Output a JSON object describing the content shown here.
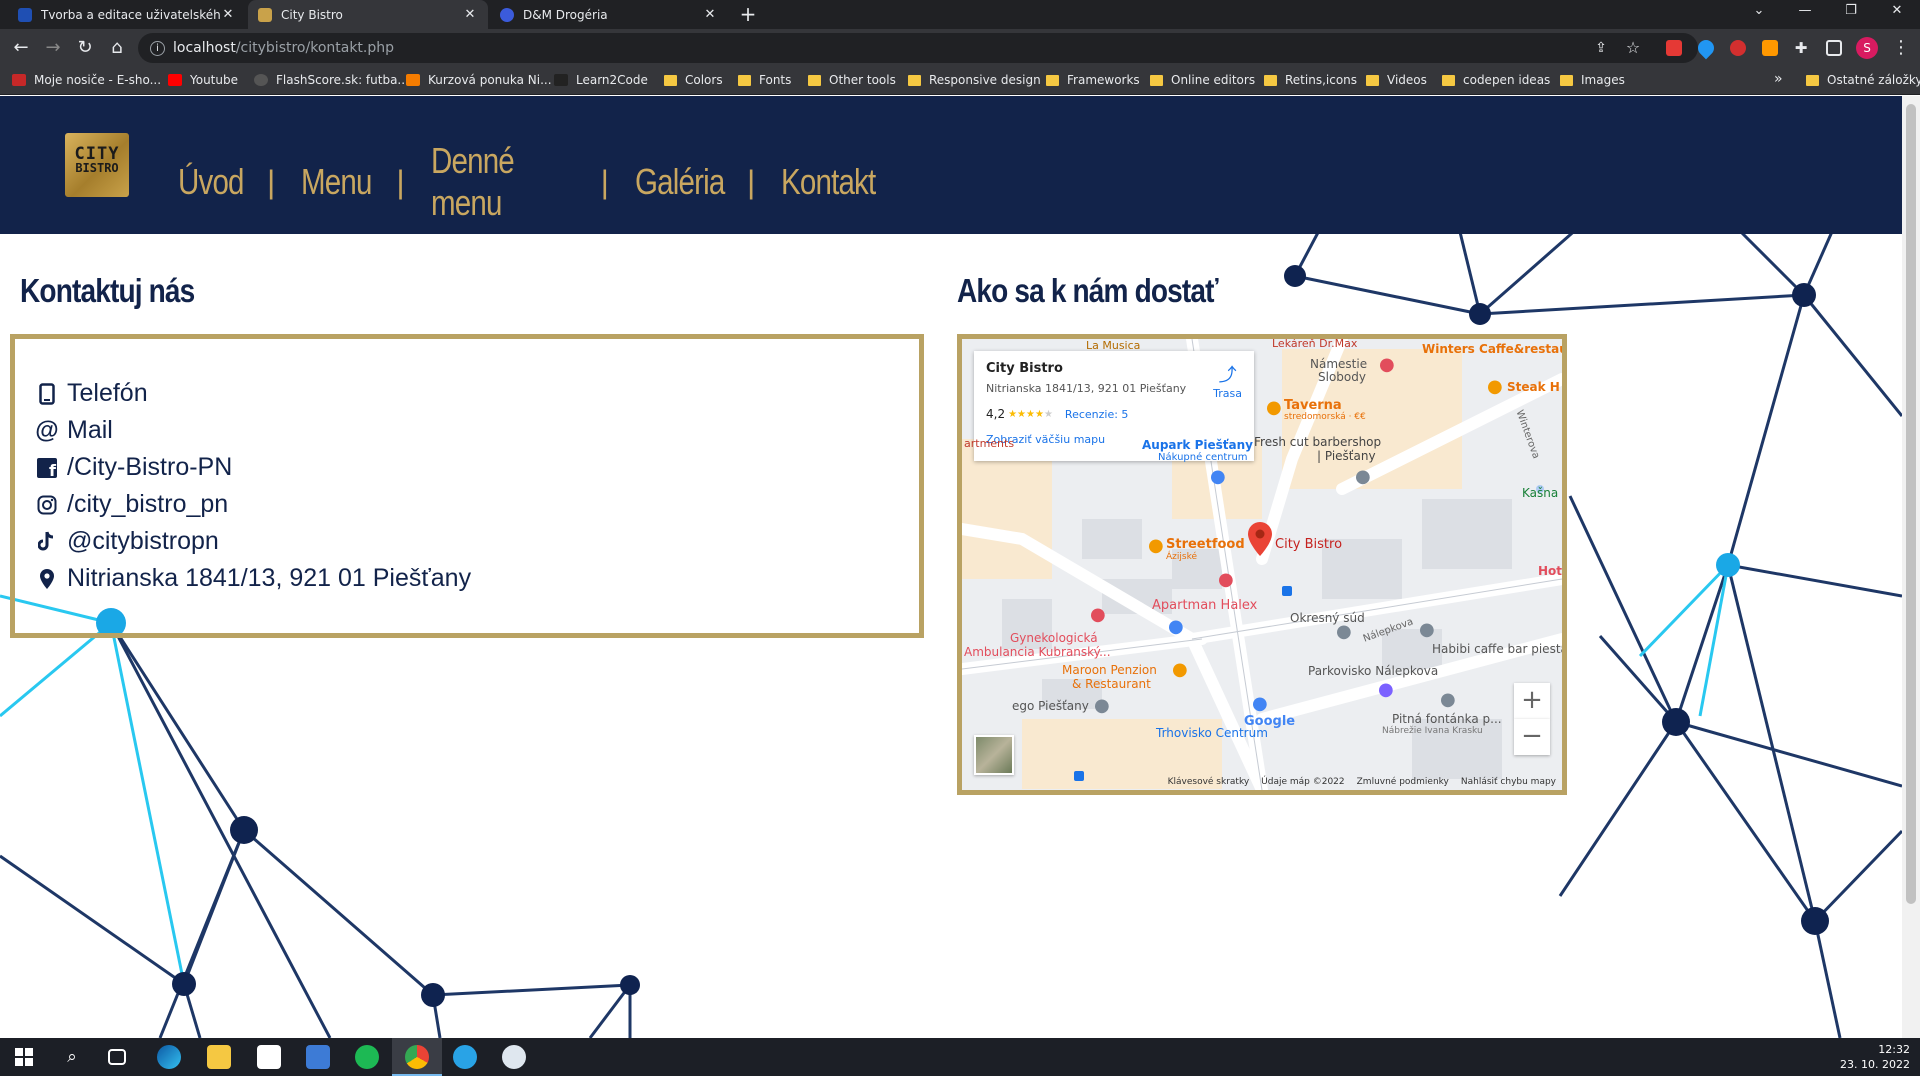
{
  "browser": {
    "tabs": [
      {
        "title": "Tvorba a editace uživatelského p",
        "icon": "sk-favicon-icon",
        "active": false
      },
      {
        "title": "City Bistro",
        "icon": "city-bistro-favicon-icon",
        "active": true
      },
      {
        "title": "D&M Drogéria",
        "icon": "dm-favicon-icon",
        "active": false
      }
    ],
    "url_host": "localhost",
    "url_path": "/citybistro/kontakt.php",
    "bookmarks": [
      "Moje nosiče - E-sho...",
      "Youtube",
      "FlashScore.sk: futba...",
      "Kurzová ponuka Ni...",
      "Learn2Code",
      "Colors",
      "Fonts",
      "Other tools",
      "Responsive design",
      "Frameworks",
      "Online editors",
      "Retins,icons",
      "Videos",
      "codepen ideas",
      "Images"
    ],
    "bookmarks_more": "»",
    "bookmarks_other": "Ostatné záložky",
    "profile_initial": "S"
  },
  "site": {
    "logo_line1": "CITY",
    "logo_line2": "BISTRO",
    "nav": [
      "Úvod",
      "Menu",
      "Denné menu",
      "Galéria",
      "Kontakt"
    ],
    "nav_separator": "|",
    "contact_heading": "Kontaktuj nás",
    "contact_items": [
      {
        "icon": "phone-icon",
        "text": "Telefón"
      },
      {
        "icon": "at-sign-icon",
        "text": "Mail"
      },
      {
        "icon": "facebook-icon",
        "text": "/City-Bistro-PN"
      },
      {
        "icon": "instagram-icon",
        "text": "/city_bistro_pn"
      },
      {
        "icon": "tiktok-icon",
        "text": "@citybistropn"
      },
      {
        "icon": "location-pin-icon",
        "text": "Nitrianska 1841/13, 921 01 Piešťany"
      }
    ],
    "map_heading": "Ako sa k nám dostať"
  },
  "map": {
    "place_name": "City Bistro",
    "place_address": "Nitrianska 1841/13, 921 01 Piešťany",
    "rating": "4,2",
    "stars": "★★★★",
    "star_empty": "★",
    "reviews": "Recenzie: 5",
    "bigger_map": "Zobraziť väčšiu mapu",
    "directions": "Trasa",
    "zoom_in": "+",
    "zoom_out": "−",
    "footer": [
      "Klávesové skratky",
      "Údaje máp ©2022",
      "Zmluvné podmienky",
      "Nahlásiť chybu mapy"
    ],
    "google": "Google",
    "labels": {
      "musica": "La Musica",
      "lekaren": "Lekáreň Dr.Max",
      "namestie": "Námestie",
      "slobody": "Slobody",
      "winters": "Winters Caffe&restaura",
      "steak": "Steak H",
      "taverna": "Taverna",
      "taverna_sub": "stredomorská · €€",
      "partments": "artments",
      "aupark": "Aupark Piešťany",
      "aupark_sub": "Nákupné centrum",
      "fresh": "Fresh cut barbershop",
      "fresh2": "| Piešťany",
      "winterova": "Winterova",
      "kasna": "Kašna",
      "streetfood": "Streetfood",
      "streetfood_sub": "Ázijské",
      "citybistro": "City Bistro",
      "hote": "Hote",
      "apartman": "Apartman Halex",
      "okresny": "Okresný súd",
      "nalepkova": "Nálepkova",
      "gyn1": "Gynekologická",
      "gyn2": "Ambulancia Kubranský...",
      "habibi": "Habibi caffe bar piestar",
      "maroon1": "Maroon Penzion",
      "maroon2": "& Restaurant",
      "parkovisko": "Parkovisko Nálepkova",
      "ego": "ego Piešťany",
      "fontanka": "Pitná fontánka p...",
      "fontanka2": "Nábrežie Ivana Krasku",
      "trhovisko": "Trhovisko Centrum"
    }
  },
  "taskbar": {
    "time": "12:32",
    "date": "23. 10. 2022"
  },
  "colors": {
    "navy": "#12234a",
    "gold": "#c9a760",
    "border_gold": "#b9a263",
    "network_line": "#1e3766",
    "network_highlight": "#29c8f0"
  }
}
